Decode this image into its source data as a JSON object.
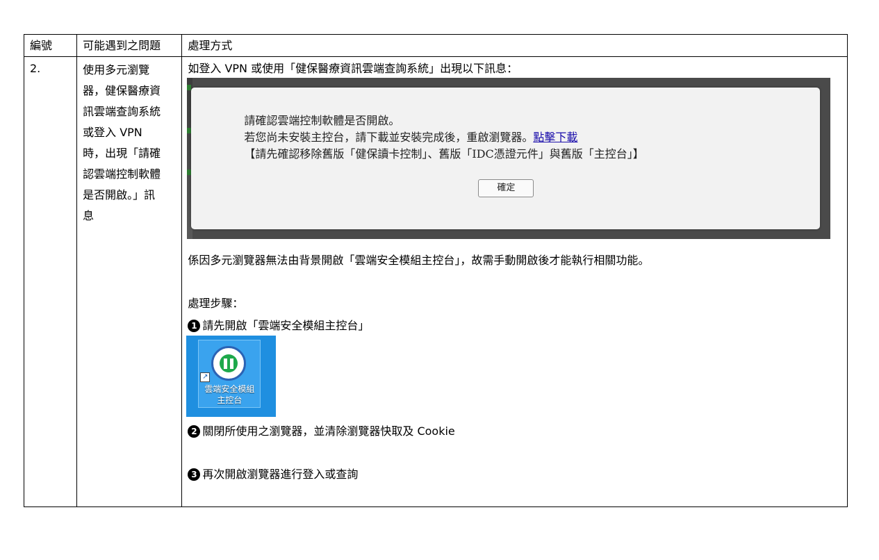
{
  "table": {
    "headers": {
      "no": "編號",
      "question": "可能遇到之問題",
      "solution": "處理方式"
    },
    "row": {
      "no": "2.",
      "question_lines": [
        "使用多元瀏覽",
        "器，健保醫療資",
        "訊雲端查詢系統",
        "或登入 VPN",
        "時，出現「請確",
        "認雲端控制軟體",
        "是否開啟。」訊",
        "息"
      ],
      "intro": "如登入 VPN 或使用「健保醫療資訊雲端查詢系統」出現以下訊息：",
      "dialog": {
        "line1": "請確認雲端控制軟體是否開啟。",
        "line2": "若您尚未安裝主控台，請下載並安裝完成後，重啟瀏覽器。",
        "link": "點擊下載",
        "line3": "【請先確認移除舊版「健保讀卡控制」、舊版「IDC憑證元件」與舊版「主控台」】",
        "ok_label": "確定"
      },
      "cause": "係因多元瀏覽器無法由背景開啟「雲端安全模組主控台」，故需手動開啟後才能執行相關功能。",
      "steps_title": "處理步驟：",
      "steps": [
        {
          "num": "1",
          "text": "請先開啟「雲端安全模組主控台」"
        },
        {
          "num": "2",
          "text": "關閉所使用之瀏覽器，並清除瀏覽器快取及 Cookie"
        },
        {
          "num": "3",
          "text": "再次開啟瀏覽器進行登入或查詢"
        }
      ],
      "desktop_icon": {
        "label_line1": "雲端安全模組",
        "label_line2": "主控台",
        "icon": "nhi-logo-icon"
      }
    }
  },
  "colors": {
    "dialog_backdrop": "#4a4a4a",
    "dialog_bg": "#f2f2f2",
    "link": "#1a0dab",
    "desktop_bg": "#1f8fe0"
  }
}
